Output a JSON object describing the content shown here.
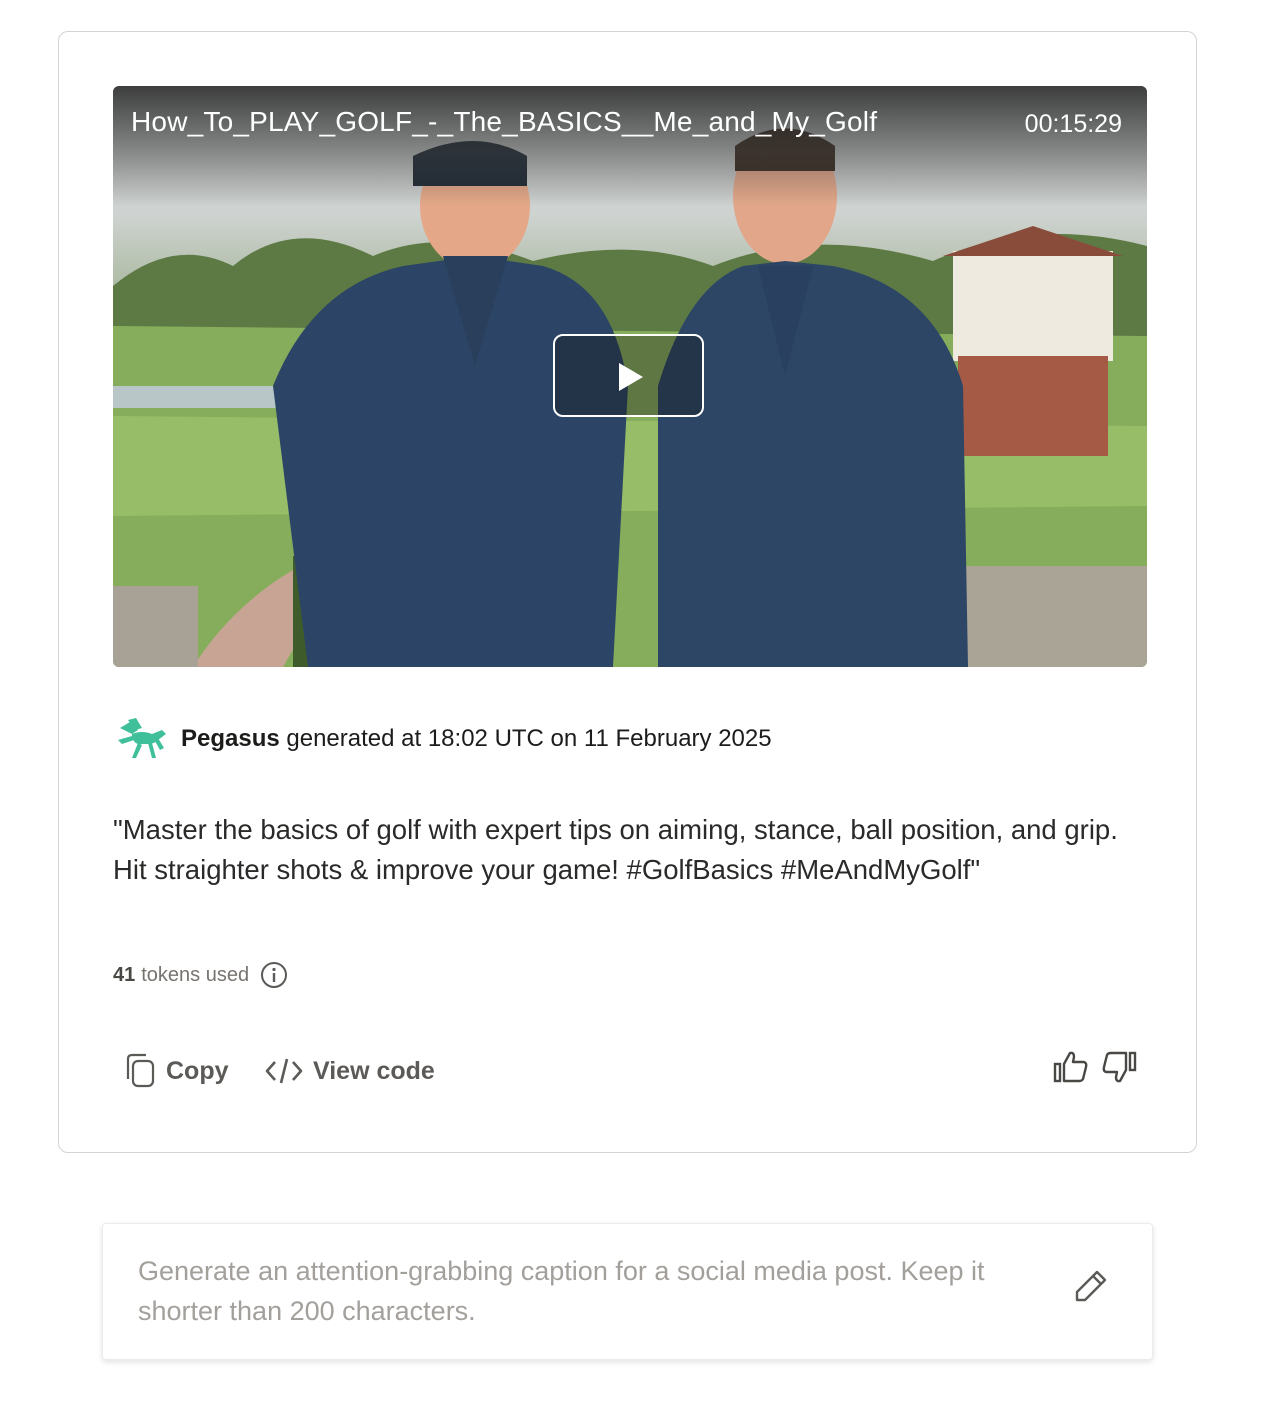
{
  "video": {
    "title": "How_To_PLAY_GOLF_-_The_BASICS__Me_and_My_Golf",
    "duration": "00:15:29",
    "play_icon": "play-icon"
  },
  "generation": {
    "model_icon": "pegasus-logo-icon",
    "model": "Pegasus",
    "meta": "generated at 18:02 UTC on 11 February 2025"
  },
  "caption": "\"Master the basics of golf with expert tips on aiming, stance, ball position, and grip. Hit straighter shots & improve your game! #GolfBasics #MeAndMyGolf\"",
  "tokens": {
    "count": "41",
    "label": "tokens used",
    "icon": "info-icon"
  },
  "actions": {
    "copy_label": "Copy",
    "copy_icon": "copy-icon",
    "view_code_label": "View code",
    "view_code_icon": "code-icon",
    "thumbs_up_icon": "thumbs-up-icon",
    "thumbs_down_icon": "thumbs-down-icon"
  },
  "prompt": {
    "text": "Generate an attention-grabbing caption for a social media post. Keep it shorter than 200 characters.",
    "icon": "pencil-icon"
  },
  "colors": {
    "pegasus_green": "#3fbf9a",
    "text_dark": "#1d1c1b",
    "text_muted": "#77746f",
    "prompt_text": "#a3a09c",
    "border": "#d6d4d2"
  }
}
